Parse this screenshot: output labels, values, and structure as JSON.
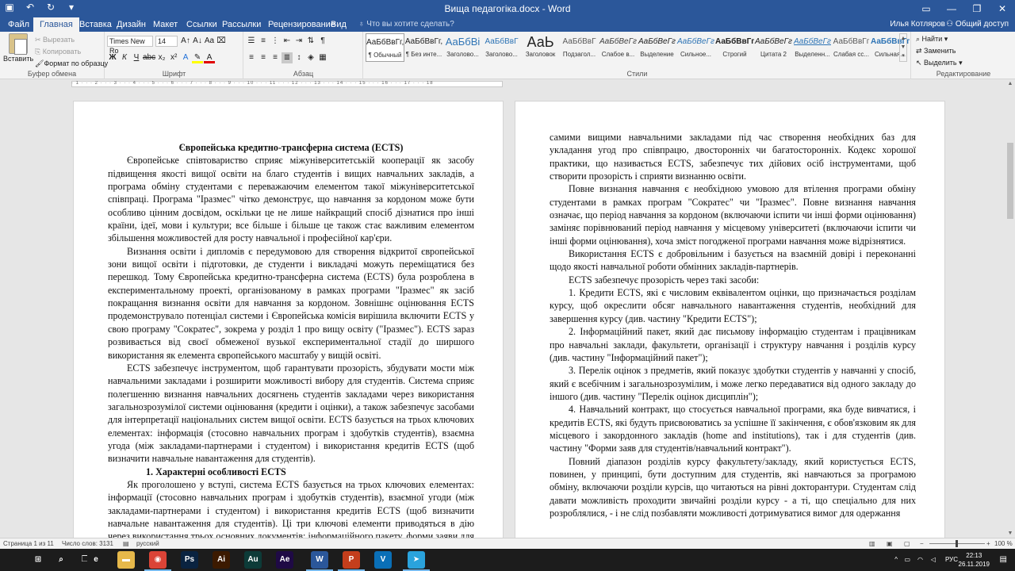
{
  "window": {
    "title": "Вища педагогіка.docx - Word",
    "user": "Илья Котляров",
    "share": "Общий доступ",
    "qat_icons": [
      "save-icon",
      "undo-icon",
      "redo-icon",
      "customize-icon"
    ],
    "controls": [
      "ribbon-options-icon",
      "minimize-icon",
      "restore-icon",
      "close-icon"
    ]
  },
  "ribbon_tabs": [
    {
      "label": "Файл"
    },
    {
      "label": "Главная",
      "active": true
    },
    {
      "label": "Вставка"
    },
    {
      "label": "Дизайн"
    },
    {
      "label": "Макет"
    },
    {
      "label": "Ссылки"
    },
    {
      "label": "Рассылки"
    },
    {
      "label": "Рецензирование"
    },
    {
      "label": "Вид"
    }
  ],
  "tell_me": "Что вы хотите сделать?",
  "clipboard": {
    "paste": "Вставить",
    "cut": "Вырезать",
    "copy": "Копировать",
    "format_painter": "Формат по образцу",
    "label": "Буфер обмена"
  },
  "font": {
    "name": "Times New Ro",
    "size": "14",
    "label": "Шрифт",
    "buttons": [
      "Ж",
      "К",
      "Ч",
      "abc",
      "x₂",
      "x²"
    ]
  },
  "paragraph": {
    "label": "Абзац"
  },
  "styles": {
    "label": "Стили",
    "items": [
      {
        "sample": "АаБбВвГг,",
        "name": "¶ Обычный",
        "selected": true
      },
      {
        "sample": "АаБбВвГг,",
        "name": "¶ Без инте..."
      },
      {
        "sample": "АаБбВі",
        "name": "Заголово..."
      },
      {
        "sample": "АаБбВвГ",
        "name": "Заголово..."
      },
      {
        "sample": "АаЬ",
        "name": "Заголовок"
      },
      {
        "sample": "АаБбВвГ",
        "name": "Подзагол..."
      },
      {
        "sample": "АаБбВеГг",
        "name": "Слабое в..."
      },
      {
        "sample": "АаБбВеГг",
        "name": "Выделение"
      },
      {
        "sample": "АаБбВеГг",
        "name": "Сильное..."
      },
      {
        "sample": "АаБбВвГг,",
        "name": "Строгий"
      },
      {
        "sample": "АаБбВеГг",
        "name": "Цитата 2"
      },
      {
        "sample": "АаБбВеГг",
        "name": "Выделенн..."
      },
      {
        "sample": "АаБбВвГг",
        "name": "Слабая сс..."
      },
      {
        "sample": "АаБбВвГг",
        "name": "Сильная..."
      }
    ]
  },
  "editing": {
    "find": "Найти",
    "replace": "Заменить",
    "select": "Выделить",
    "label": "Редактирование"
  },
  "document": {
    "page1": {
      "title": "Європейська кредитно-трансферна система (ECTS)",
      "paragraphs": [
        "Європейське співтовариство сприяє міжуніверситетській кооперації як засобу підвищення якості вищої освіти на благо студентів і вищих навчальних закладів, а програма обміну студентами є переважаючим елементом такої міжуніверситетської співпраці. Програма \"Іразмес\" чітко демонструє, що навчання за кордоном може бути особливо цінним досвідом, оскільки це не лише найкращий спосіб дізнатися про інші країни, ідеї, мови і культури; все більше і більше це також стає важливим елементом збільшення можливостей для росту навчальної і професійної кар'єри.",
        "Визнання освіти і дипломів є передумовою для створення відкритої європейської зони вищої освіти і підготовки, де студенти і викладачі можуть переміщатися без перешкод. Тому Європейська кредитно-трансферна система (ECTS) була розроблена в експериментальному проекті, організованому в рамках програми \"Іразмес\" як засіб покращання визнання освіти для навчання за кордоном. Зовнішнє оцінювання ECTS продемонструвало потенціал системи і Європейська комісія вирішила включити ECTS у свою програму \"Сократес\", зокрема у розділ 1 про вищу освіту (\"Іразмес\"). ECTS зараз розвивається від своєї обмеженої вузької експериментальної стадії до ширшого використання як елемента європейського масштабу у вищій освіті.",
        "ECTS забезпечує інструментом, щоб гарантувати прозорість, збудувати мости між навчальними закладами і розширити можливості вибору для студентів. Система сприяє полегшенню визнання навчальних досягнень студентів закладами через використання загальнозрозумілої системи оцінювання (кредити і оцінки), а також забезпечує засобами для інтерпретації національних систем вищої освіти. ECTS базується на трьох ключових елементах: інформація (стосовно навчальних програм і здобутків студентів), взаємна угода (між закладами-партнерами і студентом) і використання кредитів ECTS (щоб визначити навчальне навантаження для студентів)."
      ],
      "section_heading": "1. Характерні особливості ECTS",
      "after_heading": "Як проголошено у вступі, система ECTS базується на трьох ключових елементах: інформації (стосовно навчальних програм і здобутків студентів), взаємної угоди (між закладами-партнерами і студентом) і використання кредитів ECTS (щоб визначити навчальне навантаження для студентів). Ці три ключові елементи приводяться в дію через використання трьох основних документів: інформаційного пакету, форми заяви для студентів/навчального контракту і переліку оцінок дисциплін."
    },
    "page2": {
      "paragraphs": [
        "самими вищими навчальними закладами під час створення необхідних баз для укладання угод про співпрацю, двосторонніх чи багатосторонніх. Кодекс хорошої практики, що називається ECTS, забезпечує тих дійових осіб інструментами, щоб створити прозорість і сприяти визнанню освіти.",
        "Повне визнання навчання є необхідною умовою для втілення програми обміну студентами в рамках програм \"Сократес\" чи \"Іразмес\". Повне визнання навчання означає, що період навчання за кордоном (включаючи іспити чи інші форми оцінювання) заміняє порівнюваний період навчання у місцевому університеті (включаючи іспити чи інші форми оцінювання), хоча зміст погодженої програми навчання може відрізнятися.",
        "Використання ECTS є добровільним і базується на взаємній довірі і переконанні щодо якості навчальної роботи обмінних закладів-партнерів.",
        "ECTS забезпечує прозорість через такі засоби:",
        "1. Кредити ECTS, які є числовим еквівалентом оцінки, що призначається розділам курсу, щоб окреслити обсяг навчального навантаження студентів, необхідний для завершення курсу (див. частину \"Кредити ECTS\");",
        "2. Інформаційний пакет, який дає письмову інформацію студентам і працівникам про навчальні заклади, факультети, організації і структуру навчання і розділів курсу (див. частину \"Інформаційний пакет\");",
        "3. Перелік оцінок з предметів, який показує здобутки студентів у навчанні у спосіб, який є всебічним і загальнозрозумілим, і може легко передаватися від одного закладу до іншого (див. частину \"Перелік оцінок дисциплін\");",
        "4. Навчальний контракт, що стосується навчальної програми, яка буде вивчатися, і кредитів ECTS, які будуть присвоюватись за успішне її закінчення, є обов'язковим як для місцевого і закордонного закладів (home and institutions), так і для студентів (див. частину \"Форми заяв для студентів/навчальний контракт\").",
        "Повний діапазон розділів курсу факультету/закладу, який користується ECTS, повинен, у принципі, бути доступним для студентів, які навчаються за програмою обміну, включаючи розділи курсів, що читаються на рівні докторантури. Студентам слід давати можливість проходити звичайні розділи курсу - а ті, що спеціально для них розроблялися, - і не слід позбавляти можливості дотримуватися вимог для одержання"
      ]
    }
  },
  "status": {
    "page": "Страница 1 из 11",
    "words": "Число слов: 3131",
    "lang": "русский",
    "zoom": "100 %"
  },
  "taskbar": {
    "apps": [
      {
        "name": "windows-start-icon",
        "glyph": "⊞",
        "color": "#1c1c1c"
      },
      {
        "name": "search-icon",
        "glyph": "⌕",
        "color": "#1c1c1c"
      },
      {
        "name": "task-view-icon",
        "glyph": "❐",
        "color": "#1c1c1c"
      },
      {
        "name": "edge-icon",
        "glyph": "e",
        "color": "#1c1c1c"
      },
      {
        "name": "file-explorer-icon",
        "glyph": "▬",
        "color": "#e6b84a"
      },
      {
        "name": "chrome-icon",
        "glyph": "◉",
        "color": "#db4437"
      },
      {
        "name": "photoshop-icon",
        "glyph": "Ps",
        "color": "#0a2340"
      },
      {
        "name": "illustrator-icon",
        "glyph": "Ai",
        "color": "#3c1a00"
      },
      {
        "name": "audition-icon",
        "glyph": "Au",
        "color": "#0d3b38"
      },
      {
        "name": "after-effects-icon",
        "glyph": "Ae",
        "color": "#1f0a45"
      },
      {
        "name": "word-icon",
        "glyph": "W",
        "color": "#2b579a"
      },
      {
        "name": "powerpoint-icon",
        "glyph": "P",
        "color": "#c43e1c"
      },
      {
        "name": "visual-studio-icon",
        "glyph": "V",
        "color": "#0a6fb7"
      },
      {
        "name": "telegram-icon",
        "glyph": "➤",
        "color": "#2aa3dd"
      }
    ],
    "lang": "РУС",
    "time": "22:13",
    "date": "26.11.2019"
  }
}
